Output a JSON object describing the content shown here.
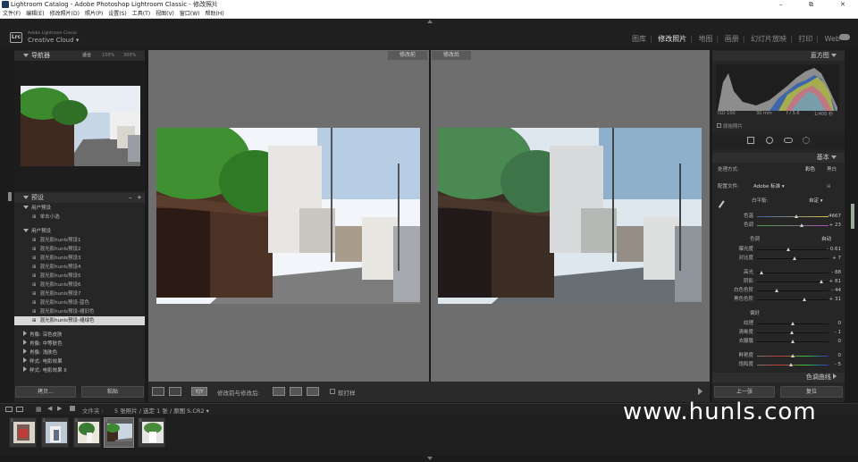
{
  "window": {
    "title": "Lightroom Catalog - Adobe Photoshop Lightroom Classic - 修改照片",
    "controls": [
      "–",
      "⧉",
      "✕"
    ]
  },
  "menu": [
    "文件(F)",
    "编辑(E)",
    "修改照片(D)",
    "照片(P)",
    "设置(S)",
    "工具(T)",
    "视图(V)",
    "窗口(W)",
    "帮助(H)"
  ],
  "identity": {
    "logo": "Lrc",
    "product": "Adobe Lightroom Classic",
    "cloud": "Creative Cloud",
    "modules": [
      "图库",
      "修改照片",
      "地图",
      "画册",
      "幻灯片放映",
      "打印",
      "Web"
    ],
    "active_module": "修改照片"
  },
  "navigator": {
    "title": "导航器",
    "zoom_options": [
      "适合",
      "100%",
      "300%"
    ]
  },
  "presets": {
    "title": "预设",
    "groups": [
      {
        "name": "用户预设",
        "items": [
          "单击小选"
        ]
      },
      {
        "name": "用户预设",
        "items": [
          "混光影hunls预设1",
          "混光影hunls预设2",
          "混光影hunls预设3",
          "混光影hunls预设4",
          "混光影hunls预设5",
          "混光影hunls预设6",
          "混光影hunls预设7",
          "混光影hunls预设-蓝色",
          "混光影hunls预设-褪旧色",
          "混光影hunls预设-褪绿色"
        ]
      }
    ],
    "selected": "混光影hunls预设-褪绿色",
    "collapsed": [
      "肖像: 深色皮肤",
      "肖像: 中等肤色",
      "肖像: 浅肤色",
      "样式: 电影效果",
      "样式: 电影效果 II"
    ],
    "import_label": "拷贝...",
    "paste_label": "粘贴"
  },
  "view": {
    "before_label": "修改前",
    "after_label": "修改后",
    "toolbar_label": "修改前与修改后:",
    "softproof_label": "软打样"
  },
  "histogram": {
    "title": "直方图",
    "iso": "ISO 100",
    "focal": "30 mm",
    "aperture": "f / 5.6",
    "shutter": "1/400 秒",
    "original_label": "原始照片"
  },
  "basic": {
    "title": "基本",
    "treatment_label": "处理方式:",
    "treatment_color": "彩色",
    "treatment_bw": "黑白",
    "profile_label": "配置文件:",
    "profile_value": "Adobe 标准",
    "wb_label": "白平衡:",
    "wb_value": "自定",
    "temp": {
      "name": "色温",
      "value": "4667",
      "pos": 0.55
    },
    "tint": {
      "name": "色调",
      "value": "+ 23",
      "pos": 0.62
    },
    "tone_label": "色调",
    "auto_label": "自动",
    "exposure": {
      "name": "曝光度",
      "value": "- 0.61",
      "pos": 0.44
    },
    "contrast": {
      "name": "对比度",
      "value": "+ 7",
      "pos": 0.53
    },
    "highlights": {
      "name": "高光",
      "value": "- 88",
      "pos": 0.06
    },
    "shadows": {
      "name": "阴影",
      "value": "+ 81",
      "pos": 0.9
    },
    "whites": {
      "name": "白色色阶",
      "value": "- 44",
      "pos": 0.28
    },
    "blacks": {
      "name": "黑色色阶",
      "value": "+ 31",
      "pos": 0.66
    },
    "presence_label": "偏好",
    "texture": {
      "name": "纹理",
      "value": "0",
      "pos": 0.5
    },
    "clarity": {
      "name": "清晰度",
      "value": "- 1",
      "pos": 0.49
    },
    "dehaze": {
      "name": "去朦胧",
      "value": "0",
      "pos": 0.5
    },
    "vibrance": {
      "name": "鲜艳度",
      "value": "0",
      "pos": 0.5
    },
    "saturation": {
      "name": "饱和度",
      "value": "- 5",
      "pos": 0.47
    }
  },
  "tone_curve_title": "色调曲线",
  "prev_label": "上一张",
  "reset_label": "复位",
  "filmstrip": {
    "path_label": "文件夹 :",
    "info": "5 张照片 / 选定 1 张 / 原图 S.CR2",
    "selected_index": 3
  },
  "watermark": "www.hunls.com"
}
